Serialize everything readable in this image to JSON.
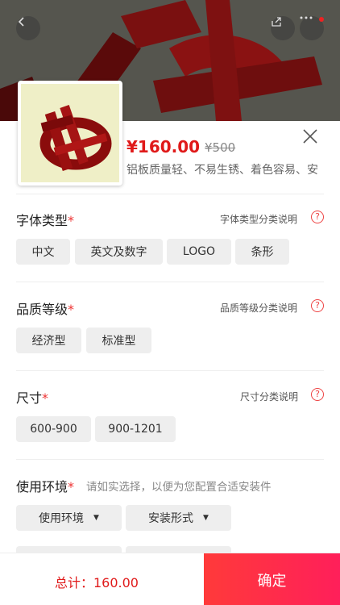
{
  "product": {
    "price": "¥160.00",
    "old_price": "¥500",
    "description": "铝板质量轻、不易生锈、着色容易、安"
  },
  "sections": {
    "font_type": {
      "title": "字体类型",
      "required": "*",
      "hint": "字体类型分类说明",
      "options": [
        "中文",
        "英文及数字",
        "LOGO",
        "条形"
      ]
    },
    "quality": {
      "title": "品质等级",
      "required": "*",
      "hint": "品质等级分类说明",
      "options": [
        "经济型",
        "标准型"
      ]
    },
    "size": {
      "title": "尺寸",
      "required": "*",
      "hint": "尺寸分类说明",
      "options": [
        "600-900",
        "900-1201"
      ]
    },
    "environment": {
      "title": "使用环境",
      "required": "*",
      "hint": "请如实选择，以便为您配置合适安装件",
      "selects": [
        "使用环境",
        "安装形式"
      ]
    }
  },
  "help_glyph": "?",
  "dropdown_glyph": "▼",
  "footer": {
    "total": "总计：160.00",
    "confirm": "确定"
  },
  "colors": {
    "accent": "#e01a1a",
    "confirm_start": "#ff3a3a",
    "confirm_end": "#ff1f5a",
    "chip_bg": "#eeeeee"
  },
  "icons": [
    "back-icon",
    "share-icon",
    "more-icon",
    "close-icon",
    "help-icon",
    "dropdown-arrow-icon"
  ]
}
